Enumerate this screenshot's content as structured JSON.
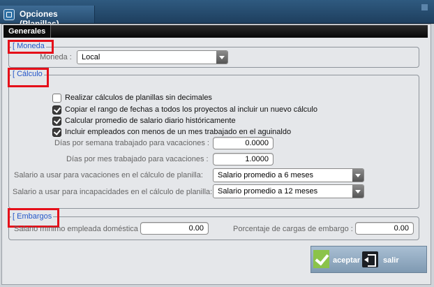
{
  "window": {
    "title": "Opciones (Planillas)"
  },
  "tabs": [
    {
      "label": "Generales"
    }
  ],
  "moneda": {
    "legend": "[ Moneda",
    "label": "Moneda :",
    "selected": "Local"
  },
  "calculo": {
    "legend": "[ Cálculo",
    "checkboxes": [
      {
        "label": "Realizar cálculos de planillas sin decimales",
        "checked": false
      },
      {
        "label": "Copiar el rango de fechas a todos los proyectos al incluir un nuevo cálculo",
        "checked": true
      },
      {
        "label": "Calcular promedio de salario diario históricamente",
        "checked": true
      },
      {
        "label": "Incluir empleados con menos de un mes trabajado en el aguinaldo",
        "checked": true
      }
    ],
    "dias_semana_label": "Días por semana trabajado para vacaciones :",
    "dias_semana_value": "0.0000",
    "dias_mes_label": "Días por mes trabajado para vacaciones :",
    "dias_mes_value": "1.0000",
    "salario_vacaciones_label": "Salario a usar para vacaciones en el cálculo de planilla:",
    "salario_vacaciones_value": "Salario promedio a 6 meses",
    "salario_incapacidades_label": "Salario a usar para incapacidades en el cálculo de planilla:",
    "salario_incapacidades_value": "Salario promedio a 12 meses"
  },
  "embargos": {
    "legend": "[ Embargos",
    "salario_minimo_label": "Salario mínimo empleada doméstica",
    "salario_minimo_value": "0.00",
    "porcentaje_label": "Porcentaje de cargas de embargo :",
    "porcentaje_value": "0.00"
  },
  "buttons": {
    "accept_label": "aceptar",
    "exit_label": "salir"
  },
  "colors": {
    "legend_text": "#2356c8",
    "highlight_box": "#e5101a",
    "titlebar": "#2f5a80",
    "accept_icon": "#8bc34a"
  }
}
